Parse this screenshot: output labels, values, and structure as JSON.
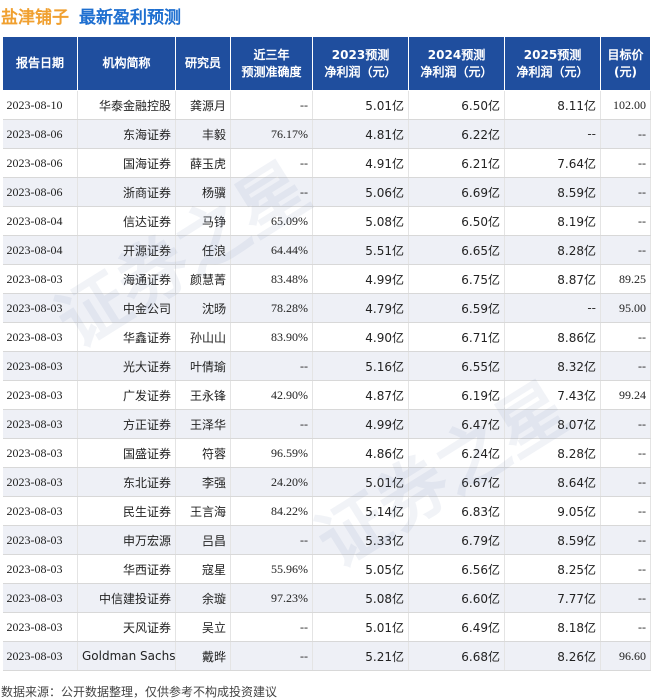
{
  "title": {
    "stock": "盐津铺子",
    "topic": "最新盈利预测"
  },
  "headers": [
    [
      "报告日期"
    ],
    [
      "机构简称"
    ],
    [
      "研究员"
    ],
    [
      "近三年",
      "预测准确度"
    ],
    [
      "2023预测",
      "净利润（元）"
    ],
    [
      "2024预测",
      "净利润（元）"
    ],
    [
      "2025预测",
      "净利润（元）"
    ],
    [
      "目标价",
      "(元)"
    ]
  ],
  "rows": [
    {
      "date": "2023-08-10",
      "inst": "华泰金融控股",
      "analyst": "龚源月",
      "acc": "--",
      "p2023": "5.01亿",
      "p2024": "6.50亿",
      "p2025": "8.11亿",
      "target": "102.00"
    },
    {
      "date": "2023-08-06",
      "inst": "东海证券",
      "analyst": "丰毅",
      "acc": "76.17%",
      "p2023": "4.81亿",
      "p2024": "6.22亿",
      "p2025": "--",
      "target": "--"
    },
    {
      "date": "2023-08-06",
      "inst": "国海证券",
      "analyst": "薛玉虎",
      "acc": "--",
      "p2023": "4.91亿",
      "p2024": "6.21亿",
      "p2025": "7.64亿",
      "target": "--"
    },
    {
      "date": "2023-08-06",
      "inst": "浙商证券",
      "analyst": "杨骥",
      "acc": "--",
      "p2023": "5.06亿",
      "p2024": "6.69亿",
      "p2025": "8.59亿",
      "target": "--"
    },
    {
      "date": "2023-08-04",
      "inst": "信达证券",
      "analyst": "马铮",
      "acc": "65.09%",
      "p2023": "5.08亿",
      "p2024": "6.50亿",
      "p2025": "8.19亿",
      "target": "--"
    },
    {
      "date": "2023-08-04",
      "inst": "开源证券",
      "analyst": "任浪",
      "acc": "64.44%",
      "p2023": "5.51亿",
      "p2024": "6.65亿",
      "p2025": "8.28亿",
      "target": "--"
    },
    {
      "date": "2023-08-03",
      "inst": "海通证券",
      "analyst": "颜慧菁",
      "acc": "83.48%",
      "p2023": "4.99亿",
      "p2024": "6.75亿",
      "p2025": "8.87亿",
      "target": "89.25"
    },
    {
      "date": "2023-08-03",
      "inst": "中金公司",
      "analyst": "沈旸",
      "acc": "78.28%",
      "p2023": "4.79亿",
      "p2024": "6.59亿",
      "p2025": "--",
      "target": "95.00"
    },
    {
      "date": "2023-08-03",
      "inst": "华鑫证券",
      "analyst": "孙山山",
      "acc": "83.90%",
      "p2023": "4.90亿",
      "p2024": "6.71亿",
      "p2025": "8.86亿",
      "target": "--"
    },
    {
      "date": "2023-08-03",
      "inst": "光大证券",
      "analyst": "叶倩瑜",
      "acc": "--",
      "p2023": "5.16亿",
      "p2024": "6.55亿",
      "p2025": "8.32亿",
      "target": "--"
    },
    {
      "date": "2023-08-03",
      "inst": "广发证券",
      "analyst": "王永锋",
      "acc": "42.90%",
      "p2023": "4.87亿",
      "p2024": "6.19亿",
      "p2025": "7.43亿",
      "target": "99.24"
    },
    {
      "date": "2023-08-03",
      "inst": "方正证券",
      "analyst": "王泽华",
      "acc": "--",
      "p2023": "4.99亿",
      "p2024": "6.47亿",
      "p2025": "8.07亿",
      "target": "--"
    },
    {
      "date": "2023-08-03",
      "inst": "国盛证券",
      "analyst": "符蓉",
      "acc": "96.59%",
      "p2023": "4.86亿",
      "p2024": "6.24亿",
      "p2025": "8.28亿",
      "target": "--"
    },
    {
      "date": "2023-08-03",
      "inst": "东北证券",
      "analyst": "李强",
      "acc": "24.20%",
      "p2023": "5.01亿",
      "p2024": "6.67亿",
      "p2025": "8.64亿",
      "target": "--"
    },
    {
      "date": "2023-08-03",
      "inst": "民生证券",
      "analyst": "王言海",
      "acc": "84.22%",
      "p2023": "5.14亿",
      "p2024": "6.83亿",
      "p2025": "9.05亿",
      "target": "--"
    },
    {
      "date": "2023-08-03",
      "inst": "申万宏源",
      "analyst": "吕昌",
      "acc": "--",
      "p2023": "5.33亿",
      "p2024": "6.79亿",
      "p2025": "8.59亿",
      "target": "--"
    },
    {
      "date": "2023-08-03",
      "inst": "华西证券",
      "analyst": "寇星",
      "acc": "55.96%",
      "p2023": "5.05亿",
      "p2024": "6.56亿",
      "p2025": "8.25亿",
      "target": "--"
    },
    {
      "date": "2023-08-03",
      "inst": "中信建投证券",
      "analyst": "余璇",
      "acc": "97.23%",
      "p2023": "5.08亿",
      "p2024": "6.60亿",
      "p2025": "7.77亿",
      "target": "--"
    },
    {
      "date": "2023-08-03",
      "inst": "天风证券",
      "analyst": "吴立",
      "acc": "--",
      "p2023": "5.01亿",
      "p2024": "6.49亿",
      "p2025": "8.18亿",
      "target": "--"
    },
    {
      "date": "2023-08-03",
      "inst": "Goldman Sachs",
      "analyst": "戴晔",
      "acc": "--",
      "p2023": "5.21亿",
      "p2024": "6.68亿",
      "p2025": "8.26亿",
      "target": "96.60"
    }
  ],
  "footer": "数据来源：公开数据整理，仅供参考不构成投资建议",
  "colors": {
    "header_bg": "#1f4e9e",
    "stock_title": "#f0a030",
    "topic_title": "#1e6fd0",
    "forecast_value": "#e0201e",
    "row_stripe": "#eef0f6"
  }
}
